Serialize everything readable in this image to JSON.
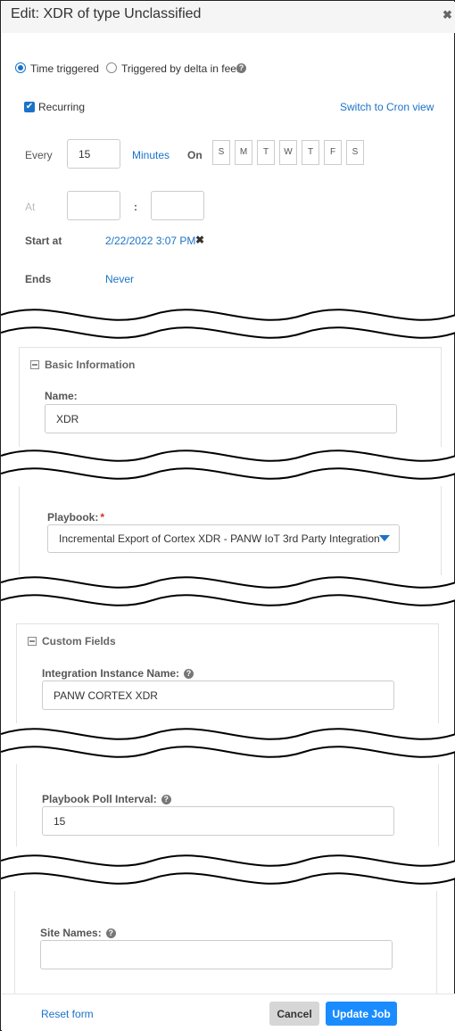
{
  "dialog": {
    "title": "Edit: XDR of type Unclassified"
  },
  "trigger": {
    "options": [
      "Time triggered",
      "Triggered by delta in feed"
    ],
    "selected": "Time triggered"
  },
  "schedule": {
    "recurring_label": "Recurring",
    "recurring_checked": true,
    "switch_link": "Switch to Cron view",
    "every_label": "Every",
    "every_value": "15",
    "unit_link": "Minutes",
    "on_label": "On",
    "days": [
      "S",
      "M",
      "T",
      "W",
      "T",
      "F",
      "S"
    ],
    "at_label": "At",
    "at_separator": ":",
    "start_label": "Start at",
    "start_value": "2/22/2022 3:07 PM",
    "ends_label": "Ends",
    "ends_value": "Never"
  },
  "basic_info": {
    "heading": "Basic Information",
    "name_label": "Name:",
    "name_value": "XDR",
    "playbook_label": "Playbook:",
    "playbook_required": "*",
    "playbook_value": "Incremental Export of Cortex XDR - PANW IoT 3rd Party Integration"
  },
  "custom_fields": {
    "heading": "Custom Fields",
    "instance_label": "Integration Instance Name:",
    "instance_value": "PANW CORTEX XDR",
    "poll_label": "Playbook Poll Interval:",
    "poll_value": "15",
    "site_label": "Site Names:",
    "site_value": ""
  },
  "footer": {
    "reset": "Reset form",
    "cancel": "Cancel",
    "update": "Update Job"
  },
  "colors": {
    "accent": "#1a73c8",
    "primary_button": "#1a8cff",
    "required": "#d32f2f"
  }
}
